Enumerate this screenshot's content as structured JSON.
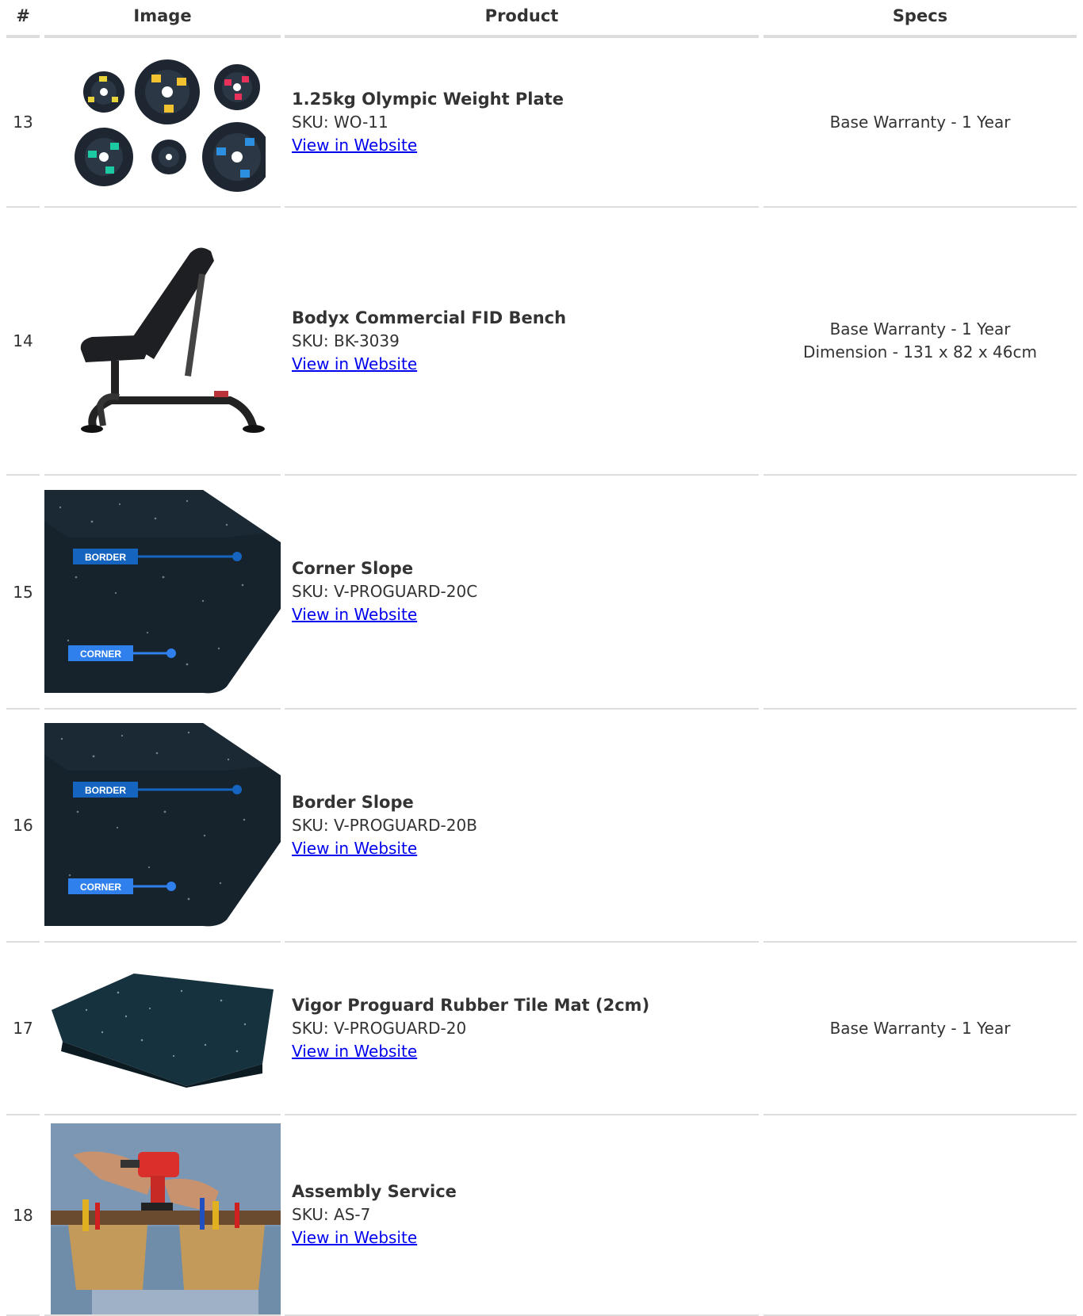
{
  "table": {
    "headers": [
      "#",
      "Image",
      "Product",
      "Specs"
    ],
    "rows": [
      {
        "num": "13",
        "image": "weight-plates-image",
        "name": "1.25kg Olympic Weight Plate",
        "sku": "SKU: WO-11",
        "link": "View in Website",
        "specs": [
          "Base Warranty - 1 Year"
        ]
      },
      {
        "num": "14",
        "image": "fid-bench-image",
        "name": "Bodyx Commercial FID Bench",
        "sku": "SKU: BK-3039",
        "link": "View in Website",
        "specs": [
          "Base Warranty - 1 Year",
          "Dimension - 131 x 82 x 46cm"
        ]
      },
      {
        "num": "15",
        "image": "corner-slope-image",
        "name": "Corner Slope",
        "sku": "SKU: V-PROGUARD-20C",
        "link": "View in Website",
        "specs": [],
        "image_labels": [
          "BORDER",
          "CORNER"
        ]
      },
      {
        "num": "16",
        "image": "border-slope-image",
        "name": "Border Slope",
        "sku": "SKU: V-PROGUARD-20B",
        "link": "View in Website",
        "specs": [],
        "image_labels": [
          "BORDER",
          "CORNER"
        ]
      },
      {
        "num": "17",
        "image": "rubber-tile-mat-image",
        "name": "Vigor Proguard Rubber Tile Mat (2cm)",
        "sku": "SKU: V-PROGUARD-20",
        "link": "View in Website",
        "specs": [
          "Base Warranty - 1 Year"
        ]
      },
      {
        "num": "18",
        "image": "assembly-service-image",
        "name": "Assembly Service",
        "sku": "SKU: AS-7",
        "link": "View in Website",
        "specs": []
      }
    ]
  },
  "colors": {
    "link": "#0000ee",
    "border": "#dddddd",
    "text": "#333333",
    "label_border": "#1565c0",
    "label_corner": "#2f80ed"
  }
}
